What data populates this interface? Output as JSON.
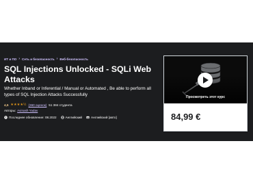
{
  "breadcrumb": [
    "ИТ и ПО",
    "Сеть и безопасность",
    "Веб-безопасность"
  ],
  "course": {
    "title": "SQL Injections Unlocked - SQLi Web Attacks",
    "subtitle": "Whether Inband or Inferential / Manual or Automated , Be able to perform all types of SQL Injection Attacks Successfully",
    "rating_value": "4,5",
    "stars": "★★★★½",
    "rating_count": "(360 оценок)",
    "students": "51 384 студента",
    "author_label": "Авторы:",
    "author_name": "Avinash Yadav",
    "updated": "Последнее обновление: 08.2022",
    "language": "Английский",
    "captions": "Английский [авто]"
  },
  "sidebar": {
    "preview_label": "Просмотреть этот курс",
    "price": "84,99 €"
  },
  "colors": {
    "hero_bg": "#1c1d1f",
    "link": "#cec0fc",
    "star": "#e59819",
    "rating": "#f3ca8c"
  }
}
